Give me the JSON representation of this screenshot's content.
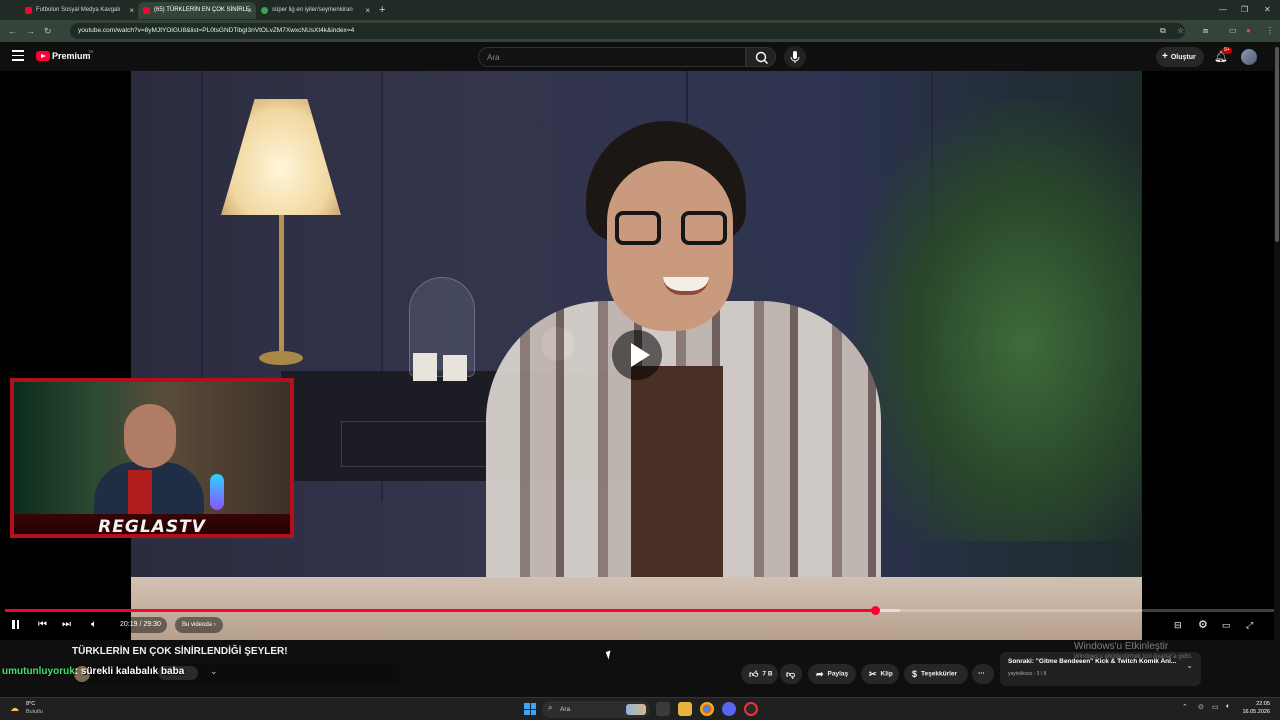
{
  "browser": {
    "tabs": [
      {
        "label": "Futbolun Sosyal Medya Kavgalı",
        "active": false
      },
      {
        "label": "(65) TÜRKLERİN EN ÇOK SİNİRLE",
        "active": true
      },
      {
        "label": "süper lig en iyiler/seymenkiran",
        "active": false
      }
    ],
    "url": "youtube.com/watch?v=8yMJtYOiGU8&list=PL0tsGNDTibgI3nVtOLvZM7XwxcNUsXt4k&index=4"
  },
  "masthead": {
    "brand": "Premium",
    "brand_region": "TR",
    "search_placeholder": "Ara",
    "create_label": "Oluştur",
    "notifications_badge": "9+"
  },
  "player": {
    "time_display": "20:19 / 29:30",
    "chapter_label": "Bu videoda",
    "progress_played": 0.685,
    "progress_buffered": 0.705,
    "webcam_logo": "REGLASTV"
  },
  "video": {
    "title": "TÜRKLERİN EN ÇOK SİNİRLENDİĞİ ŞEYLER!"
  },
  "chat": {
    "user": "umutunluyoruk",
    "separator": ": ",
    "message": "sürekli kalabalık baba"
  },
  "actions": {
    "like_count": "7 B",
    "share_label": "Paylaş",
    "clip_label": "Klip",
    "thanks_label": "Teşekkürler"
  },
  "next_card": {
    "title": "Sonraki: \"Gitme Bendeeen\" Kick & Twitch Komik Anl...",
    "subtitle": "yayinlıksss - 3 / 8"
  },
  "windows_activation": {
    "title": "Windows'u Etkinleştir",
    "subtitle": "Windows'u etkinleştirmek için Ayarlar'a gidin."
  },
  "taskbar": {
    "weather_temp": "8°C",
    "weather_desc": "Bulutlu",
    "search_placeholder": "Ara",
    "time": "22:05",
    "date": "16.05.2026"
  },
  "colors": {
    "accent": "#ff0033",
    "chat_user": "#44e06d",
    "webcam_frame": "#b4101b"
  }
}
